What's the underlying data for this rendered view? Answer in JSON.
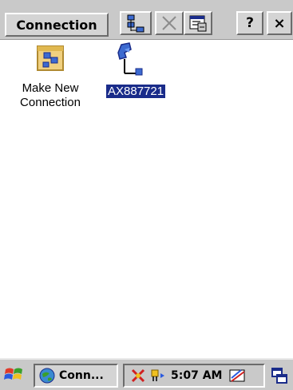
{
  "toolbar": {
    "title": "Connection",
    "help_label": "?",
    "close_label": "×"
  },
  "items": [
    {
      "label_line1": "Make New",
      "label_line2": "Connection"
    },
    {
      "label": "AX887721"
    }
  ],
  "taskbar": {
    "task_label": "Conn...",
    "clock": "5:07 AM"
  },
  "colors": {
    "selection": "#1a2c8a",
    "chrome": "#c9c9c9"
  }
}
